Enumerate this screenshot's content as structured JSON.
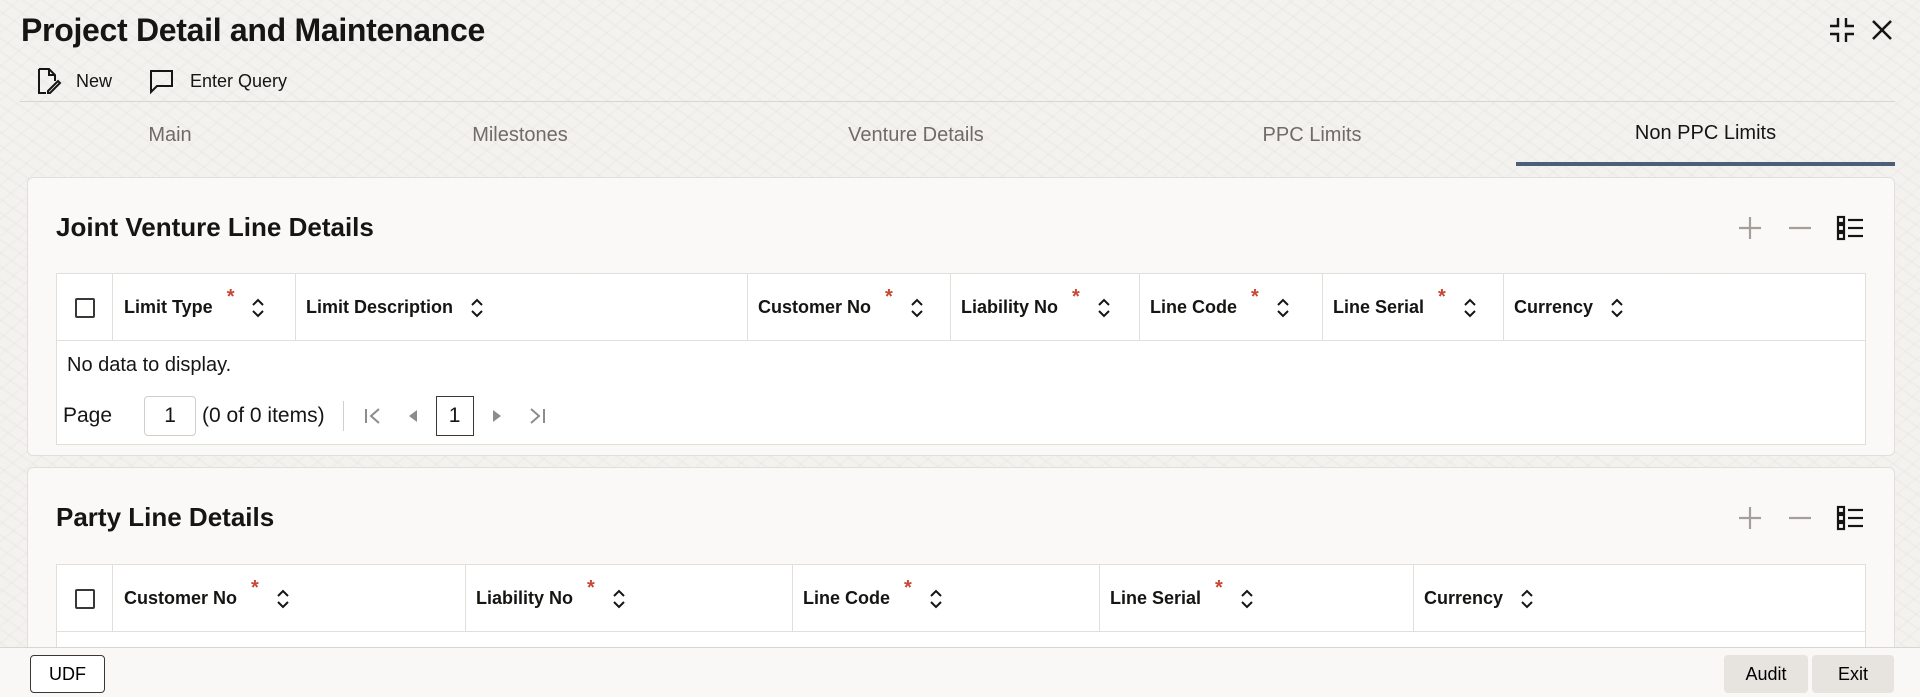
{
  "window": {
    "title": "Project Detail and Maintenance",
    "icons": [
      "minimize-icon",
      "close-icon"
    ]
  },
  "toolbar": {
    "new_label": "New",
    "enter_query_label": "Enter Query"
  },
  "tabs": [
    {
      "label": "Main",
      "active": false
    },
    {
      "label": "Milestones",
      "active": false
    },
    {
      "label": "Venture Details",
      "active": false
    },
    {
      "label": "PPC Limits",
      "active": false
    },
    {
      "label": "Non PPC Limits",
      "active": true
    }
  ],
  "joint_venture": {
    "title": "Joint Venture Line Details",
    "columns": [
      {
        "label": "Limit Type",
        "required": true
      },
      {
        "label": "Limit Description",
        "required": false
      },
      {
        "label": "Customer No",
        "required": true
      },
      {
        "label": "Liability No",
        "required": true
      },
      {
        "label": "Line Code",
        "required": true
      },
      {
        "label": "Line Serial",
        "required": true
      },
      {
        "label": "Currency",
        "required": false
      }
    ],
    "empty_text": "No data to display.",
    "pager": {
      "page_label": "Page",
      "page_value": "1",
      "items_text": "(0 of 0 items)",
      "current_page": "1"
    }
  },
  "party_line": {
    "title": "Party Line Details",
    "columns": [
      {
        "label": "Customer No",
        "required": true
      },
      {
        "label": "Liability No",
        "required": true
      },
      {
        "label": "Line Code",
        "required": true
      },
      {
        "label": "Line Serial",
        "required": true
      },
      {
        "label": "Currency",
        "required": false
      }
    ]
  },
  "footer": {
    "udf_label": "UDF",
    "audit_label": "Audit",
    "exit_label": "Exit"
  },
  "colors": {
    "accent": "#4d5f77",
    "required": "#c74634"
  }
}
